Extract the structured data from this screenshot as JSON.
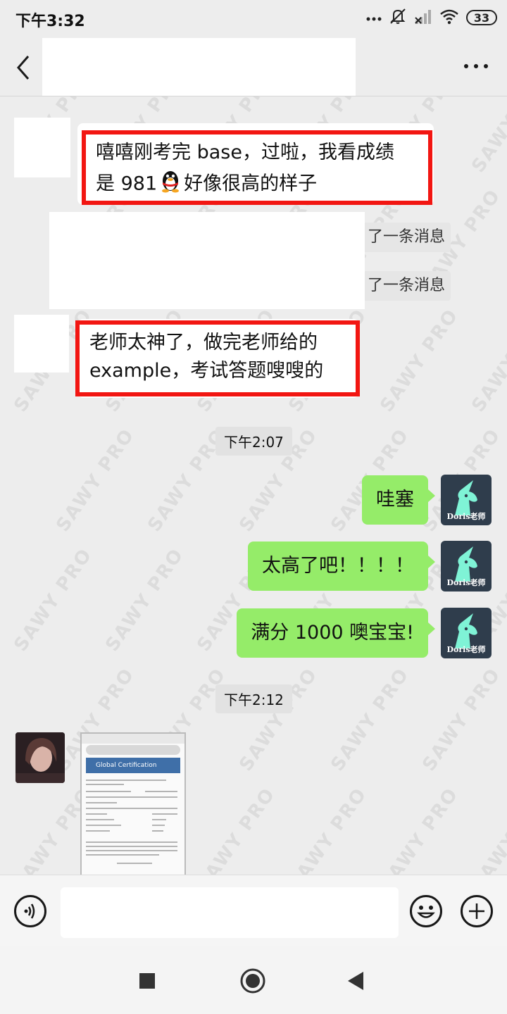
{
  "status_bar": {
    "time": "下午3:32",
    "battery": "33",
    "icons": [
      "dots-icon",
      "mute-icon",
      "signal-icon",
      "wifi-icon",
      "battery-icon"
    ]
  },
  "header": {
    "back_icon": "chevron-left-icon",
    "more_icon": "more-dots-icon"
  },
  "watermark": "SAWY PRO",
  "messages": {
    "m1": {
      "line1": "嘻嘻刚考完 base，过啦，我看成绩",
      "line2": "是 981",
      "emoji": "qq-penguin-icon",
      "line2_after": "好像很高的样子"
    },
    "sys1": "了一条消息",
    "sys2": "了一条消息",
    "m2": {
      "line1": "老师太神了，做完老师给的",
      "line2": "example，考试答题嗖嗖的"
    },
    "time1": "下午2:07",
    "r1": "哇塞",
    "r2": "太高了吧！！！！",
    "r3": "满分 1000 噢宝宝!",
    "time2": "下午2:12",
    "doris_label": "Doris老师",
    "image_caption": "Global Certification"
  },
  "input_bar": {
    "voice_icon": "voice-icon",
    "emoji_icon": "smiley-icon",
    "plus_icon": "plus-icon",
    "input_value": ""
  },
  "nav_bar": {
    "icons": [
      "square-icon",
      "home-circle-icon",
      "back-triangle-icon"
    ]
  },
  "colors": {
    "background": "#ededed",
    "sent_bubble": "#95ec69",
    "highlight_border": "#f21612",
    "doris_avatar": "#2f3d4c",
    "unicorn": "#7ff3d6"
  }
}
